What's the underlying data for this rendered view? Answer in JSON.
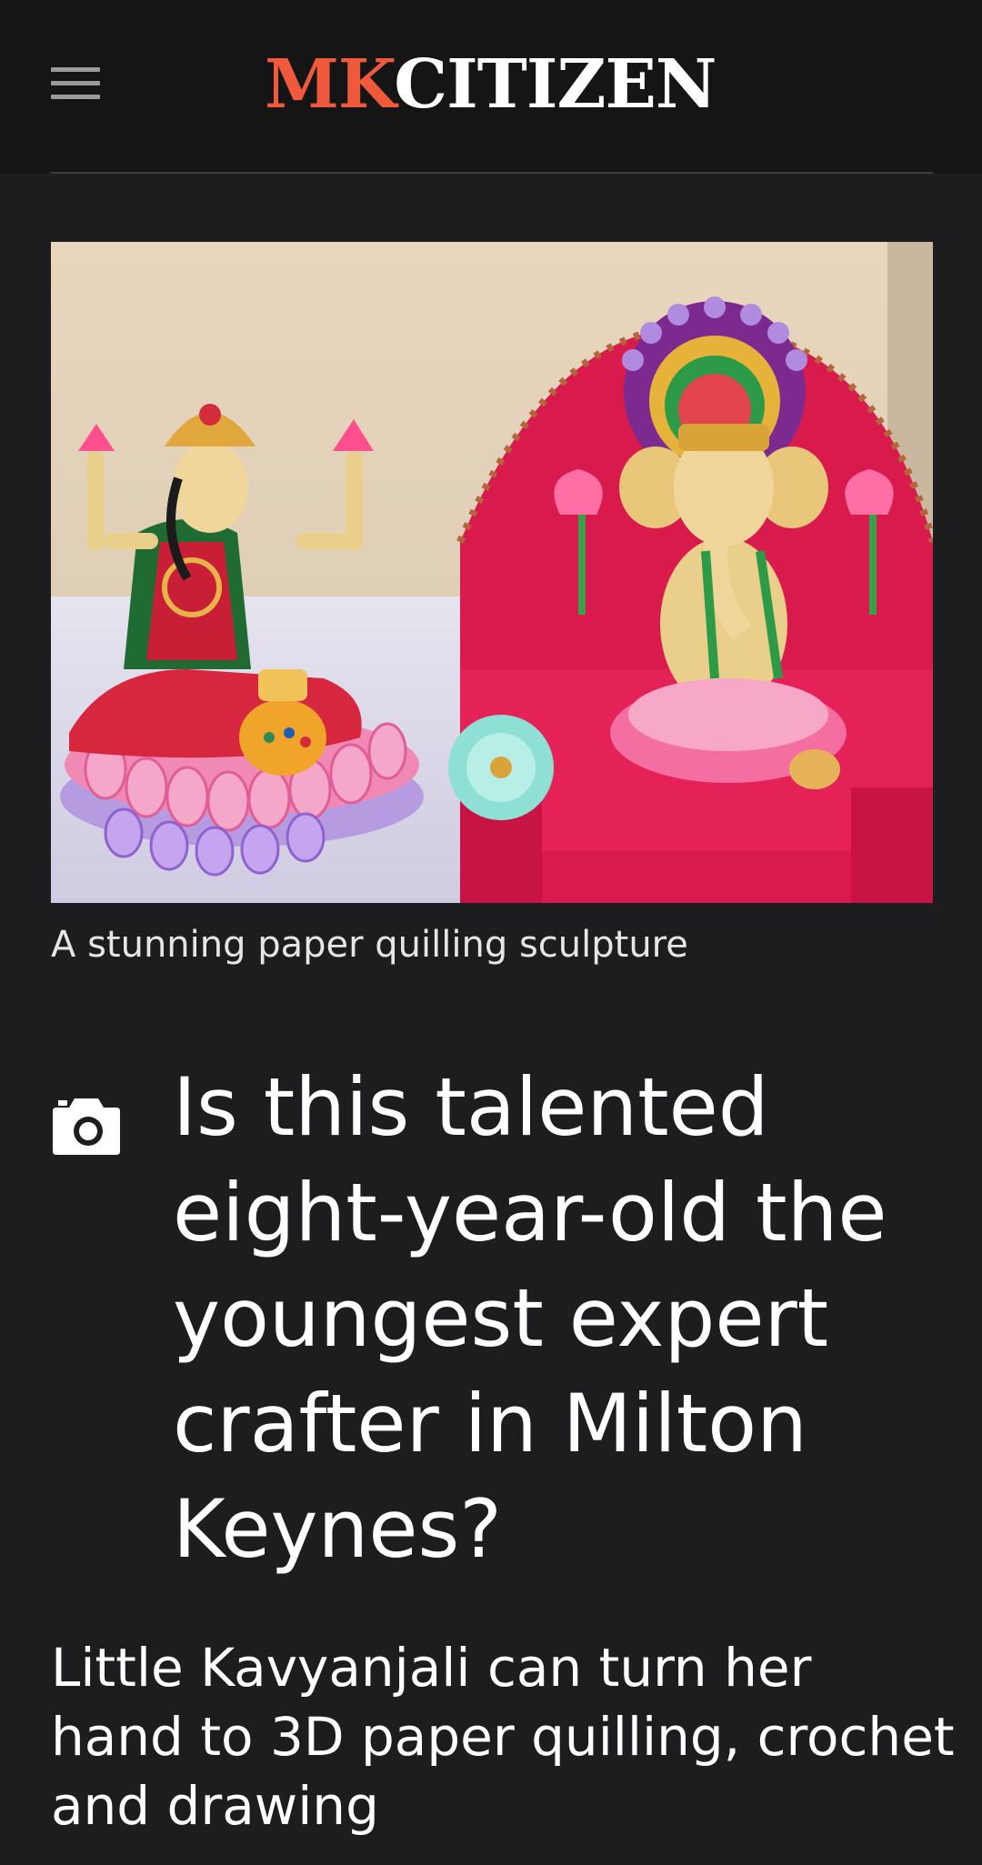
{
  "header": {
    "logo_part1": "MK",
    "logo_part2": "CITIZEN",
    "menu_icon": "hamburger-menu-icon"
  },
  "article": {
    "image_caption": "A stunning paper quilling sculpture",
    "media_icon": "camera-icon",
    "headline": "Is this talented eight-year-old the youngest expert crafter in Milton Keynes?",
    "standfirst": "Little Kavyanjali can turn her hand to 3D paper quilling, crochet and drawing"
  },
  "colors": {
    "brand_accent": "#ee5a3b",
    "header_bg": "#151515",
    "page_bg": "#1d1d1f"
  }
}
